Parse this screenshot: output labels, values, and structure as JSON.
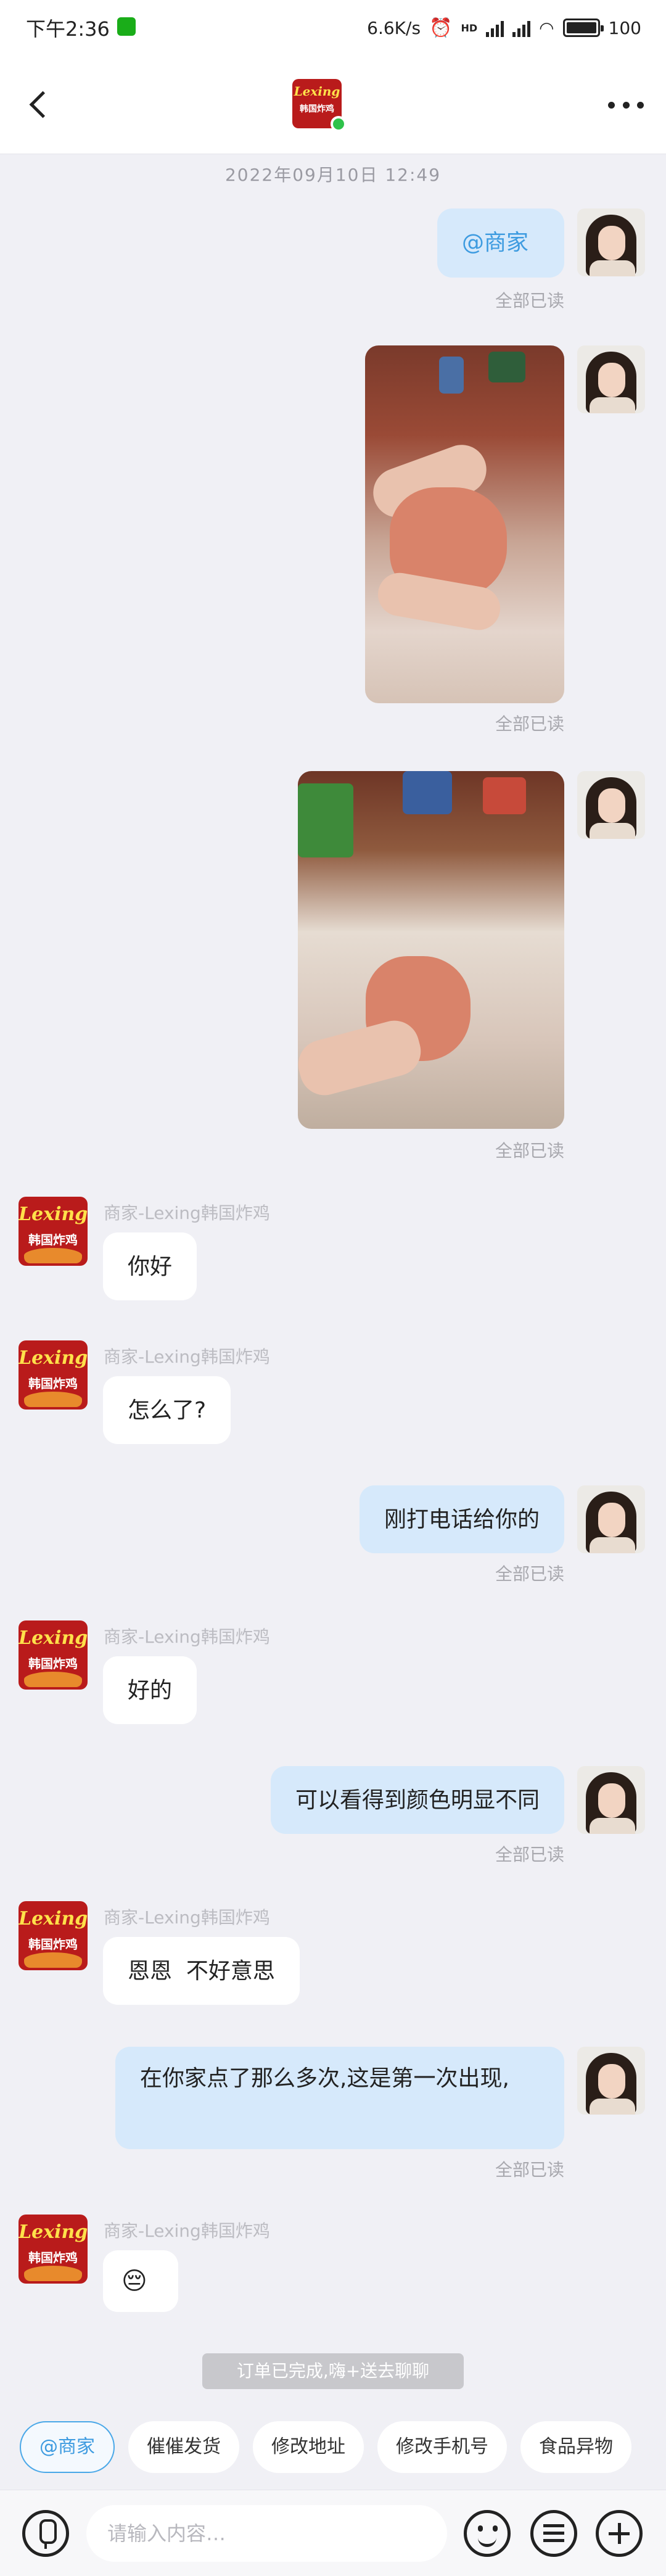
{
  "status_bar": {
    "time": "下午2:36",
    "net_speed": "6.6K/s",
    "signal_tag": "HD",
    "battery": "100",
    "battery_level": 1.0
  },
  "header": {
    "logo_text": "Lexing",
    "logo_cn": "韩国炸鸡",
    "online": true
  },
  "chat": {
    "timestamp": "2022年09月10日 12:49",
    "read_status": "全部已读",
    "shop_name": "商家-Lexing韩国炸鸡",
    "messages": {
      "m1": "@商家",
      "m5": "你好",
      "m6": "怎么了?",
      "m7": "刚打电话给你的",
      "m8": "好的",
      "m9": "可以看得到颜色明显不同",
      "m10": "恩恩  不好意思",
      "m11": "在你家点了那么多次,这是第一次出现,",
      "m12": "😔"
    },
    "system_notice": "订单已完成,嗨+送去聊聊"
  },
  "quick_replies": [
    "@商家",
    "催催发货",
    "修改地址",
    "修改手机号",
    "食品异物"
  ],
  "input": {
    "placeholder": "请输入内容…"
  },
  "colors": {
    "outgoing_bubble": "#d6e9fb",
    "incoming_bubble": "#ffffff",
    "background": "#f0f0f5",
    "mention": "#3d9be0",
    "logo_red": "#b91b1b"
  }
}
